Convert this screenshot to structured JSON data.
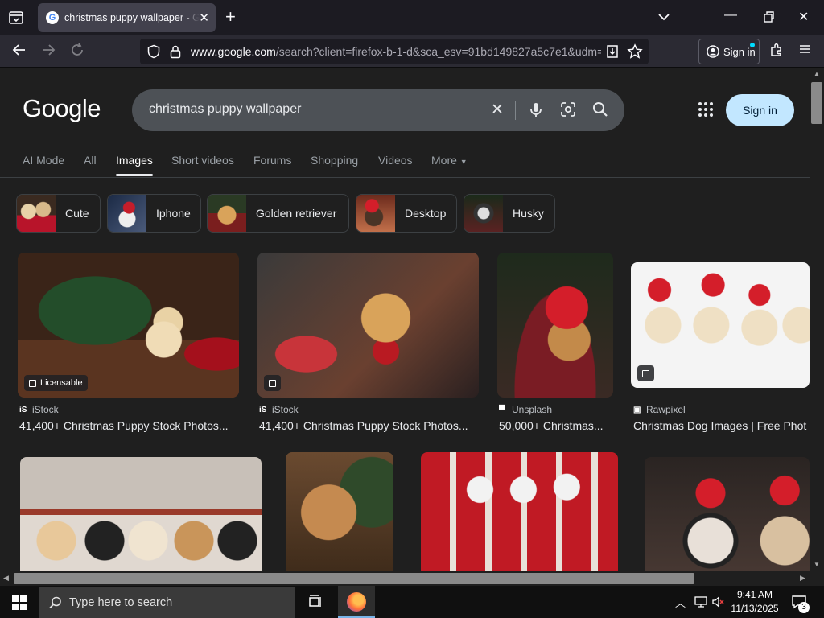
{
  "browser": {
    "tab_title": "christmas puppy wallpaper - Google Search",
    "url_host": "www.google.com",
    "url_path": "/search?client=firefox-b-1-d&sca_esv=91bd149827a5c7e1&udm=",
    "signin_label": "Sign in"
  },
  "google": {
    "logo_text": "Google",
    "query": "christmas puppy wallpaper",
    "signin_label": "Sign in",
    "tabs": [
      {
        "label": "AI Mode"
      },
      {
        "label": "All"
      },
      {
        "label": "Images",
        "active": true
      },
      {
        "label": "Short videos"
      },
      {
        "label": "Forums"
      },
      {
        "label": "Shopping"
      },
      {
        "label": "Videos"
      },
      {
        "label": "More"
      }
    ],
    "chips": [
      {
        "label": "Cute"
      },
      {
        "label": "Iphone"
      },
      {
        "label": "Golden retriever"
      },
      {
        "label": "Desktop"
      },
      {
        "label": "Husky"
      }
    ],
    "results": [
      {
        "badge": "Licensable",
        "source": "iStock",
        "source_icon": "iS",
        "caption": "41,400+ Christmas Puppy Stock Photos..."
      },
      {
        "source": "iStock",
        "source_icon": "iS",
        "caption": "41,400+ Christmas Puppy Stock Photos..."
      },
      {
        "source": "Unsplash",
        "source_icon": "▀",
        "caption": "50,000+ Christmas..."
      },
      {
        "source": "Rawpixel",
        "source_icon": "▣",
        "caption": "Christmas Dog Images | Free Phot"
      }
    ]
  },
  "taskbar": {
    "search_placeholder": "Type here to search",
    "time": "9:41 AM",
    "date": "11/13/2025",
    "notification_count": "3"
  },
  "colors": {
    "page_bg": "#1f1f1f",
    "signin_bg": "#c2e7ff",
    "searchbox_bg": "#4d5156"
  }
}
